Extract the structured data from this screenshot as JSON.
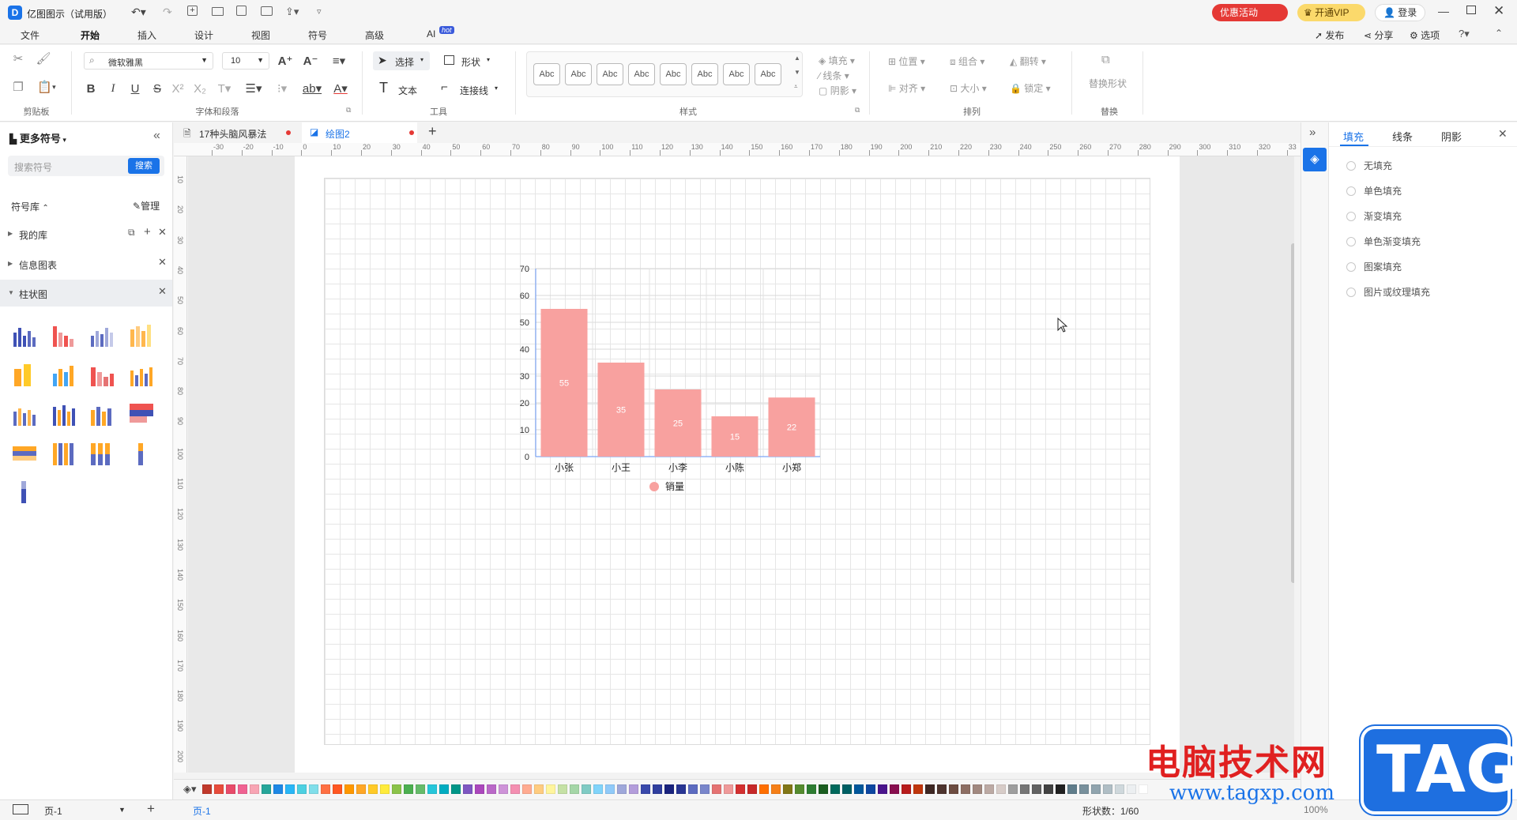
{
  "app": {
    "title": "亿图图示（试用版）",
    "promo_label": "优惠活动",
    "vip_label": "开通VIP",
    "login_label": "登录"
  },
  "menu": {
    "items": [
      "文件",
      "开始",
      "插入",
      "设计",
      "视图",
      "符号",
      "高级",
      "AI"
    ],
    "hot_badge": "hot",
    "right_actions": [
      "发布",
      "分享",
      "选项"
    ]
  },
  "ribbon": {
    "font_name": "微软雅黑",
    "font_size": "10",
    "select_label": "选择",
    "shape_label": "形状",
    "text_label": "文本",
    "connector_label": "连接线",
    "style_samples": [
      "Abc",
      "Abc",
      "Abc",
      "Abc",
      "Abc",
      "Abc",
      "Abc",
      "Abc"
    ],
    "fill_label": "填充",
    "line_label": "线条",
    "shadow_label": "阴影",
    "position_label": "位置",
    "group_label": "组合",
    "flip_label": "翻转",
    "align_label": "对齐",
    "size_label": "大小",
    "lock_label": "锁定",
    "replace_shape_label": "替换形状",
    "groups": [
      "剪贴板",
      "字体和段落",
      "工具",
      "样式",
      "排列",
      "替换"
    ]
  },
  "left_panel": {
    "title": "更多符号",
    "search_placeholder": "搜索符号",
    "search_button": "搜索",
    "library_label": "符号库",
    "manage_label": "管理",
    "libraries": [
      "我的库",
      "信息图表",
      "柱状图"
    ]
  },
  "tabs": [
    {
      "label": "17种头脑风暴法"
    },
    {
      "label": "绘图2"
    }
  ],
  "ruler": {
    "h_ticks": [
      "-30",
      "-20",
      "-10",
      "0",
      "10",
      "20",
      "30",
      "40",
      "50",
      "60",
      "70",
      "80",
      "90",
      "100",
      "110",
      "120",
      "130",
      "140",
      "150",
      "160",
      "170",
      "180",
      "190",
      "200",
      "210",
      "220",
      "230",
      "240",
      "250",
      "260",
      "270",
      "280",
      "290",
      "300",
      "310",
      "320",
      "33"
    ],
    "v_ticks": [
      "10",
      "20",
      "30",
      "40",
      "50",
      "60",
      "70",
      "80",
      "90",
      "100",
      "110",
      "120",
      "130",
      "140",
      "150",
      "160",
      "170",
      "180",
      "190",
      "200"
    ]
  },
  "chart_data": {
    "type": "bar",
    "categories": [
      "小张",
      "小王",
      "小李",
      "小陈",
      "小郑"
    ],
    "series": [
      {
        "name": "销量",
        "values": [
          55,
          35,
          25,
          15,
          22
        ]
      }
    ],
    "ylim": [
      0,
      70
    ],
    "yticks": [
      "0",
      "10",
      "20",
      "30",
      "40",
      "50",
      "60",
      "70"
    ],
    "bar_color": "#f8a19f",
    "grid": true,
    "legend_position": "bottom",
    "title": "",
    "xlabel": "",
    "ylabel": ""
  },
  "right_panel": {
    "tabs": [
      "填充",
      "线条",
      "阴影"
    ],
    "options": [
      "无填充",
      "单色填充",
      "渐变填充",
      "单色渐变填充",
      "图案填充",
      "图片或纹理填充"
    ]
  },
  "status": {
    "page_label": "页-1",
    "page_tab": "页-1",
    "shape_count": "形状数：1/60",
    "zoom": "100%"
  },
  "watermark": {
    "text": "电脑技术网",
    "url": "www.tagxp.com",
    "badge": "TAG"
  },
  "colors": {
    "accent": "#1a73e8",
    "promo": "#e53935",
    "vip": "#fbd96b"
  },
  "palette": [
    "#c0392b",
    "#e74c3c",
    "#e84b6a",
    "#f06292",
    "#f8a5b4",
    "#26a69a",
    "#1e88e5",
    "#29b6f6",
    "#4dd0e1",
    "#80deea",
    "#ff7043",
    "#ff5722",
    "#ff9800",
    "#ffa726",
    "#ffca28",
    "#ffeb3b",
    "#8bc34a",
    "#4caf50",
    "#66bb6a",
    "#26c6da",
    "#00acc1",
    "#009688",
    "#7e57c2",
    "#ab47bc",
    "#ba68c8",
    "#ce93d8",
    "#f48fb1",
    "#ffab91",
    "#ffcc80",
    "#fff59d",
    "#c5e1a5",
    "#a5d6a7",
    "#80cbc4",
    "#81d4fa",
    "#90caf9",
    "#9fa8da",
    "#b39ddb",
    "#3949ab",
    "#303f9f",
    "#1a237e",
    "#283593",
    "#5c6bc0",
    "#7986cb",
    "#e57373",
    "#ef9a9a",
    "#d32f2f",
    "#c62828",
    "#ff6f00",
    "#f57f17",
    "#827717",
    "#558b2f",
    "#2e7d32",
    "#1b5e20",
    "#00695c",
    "#006064",
    "#01579b",
    "#0d47a1",
    "#4a148c",
    "#880e4f",
    "#b71c1c",
    "#bf360c",
    "#3e2723",
    "#4e342e",
    "#6d4c41",
    "#8d6e63",
    "#a1887f",
    "#bcaaa4",
    "#d7ccc8",
    "#9e9e9e",
    "#757575",
    "#616161",
    "#424242",
    "#212121",
    "#607d8b",
    "#78909c",
    "#90a4ae",
    "#b0bec5",
    "#cfd8dc",
    "#eceff1",
    "#ffffff"
  ]
}
